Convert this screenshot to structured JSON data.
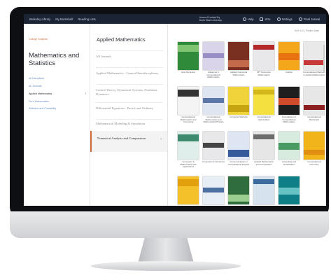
{
  "topbar": {
    "nav": [
      "Berkeley Library",
      "My Bookshelf",
      "Reading Lists"
    ],
    "access_line1": "Access Provided By",
    "access_line2": "North State University",
    "help": "Help",
    "size": "Size",
    "settings": "Settings",
    "account": "Pinal Jaswal"
  },
  "left": {
    "breadcrumb": "College Subjects",
    "subject_title": "Mathematics and Statistics",
    "links": [
      "All Disciplines",
      "All Journals"
    ],
    "active_item": "Applied Mathematics",
    "more_links": [
      "Pure Mathematics",
      "Statistics and Probability"
    ]
  },
  "middle": {
    "title": "Applied Mathematics",
    "items": [
      "All Journals",
      "Applied Mathematics - General/Interdisciplinary",
      "Control Theory, Dynamical Systems, Nonlinear Dynamics",
      "Differential Equations - Partial and Ordinary",
      "Mathematical Modeling & Simulation"
    ],
    "active": "Numerical Analysis and Computation"
  },
  "right": {
    "sort_label": "Sort: A-Z | Publish Date",
    "covers": [
      {
        "title": "Acta Numerica",
        "bg": "#2f8a3a",
        "accent": "#7fc470"
      },
      {
        "title": "Advances in Computational Mathematics",
        "bg": "#d9d4e9",
        "accent": "#9a8fc4"
      },
      {
        "title": "Applied Numerical Mathematics",
        "bg": "#7a3020",
        "accent": "#c26a4a"
      },
      {
        "title": "BIT Numerical Mathematics",
        "bg": "#e8e8ea",
        "accent": "#b52b2b"
      },
      {
        "title": "Calcolo",
        "bg": "#f3a81c",
        "accent": "#e7720f"
      },
      {
        "title": "Computational Methods in Applied Mathematics",
        "bg": "#e9e9e9",
        "accent": "#c83a3a"
      },
      {
        "title": "Computational Mathematics and Computing",
        "bg": "#f4f4f4",
        "accent": "#333333"
      },
      {
        "title": "Computational Mathematics and Mathematical Physics",
        "bg": "#dfe6f2",
        "accent": "#5b76a8"
      },
      {
        "title": "Computer Methods",
        "bg": "#f0d23b",
        "accent": "#c7a512"
      },
      {
        "title": "Computational Optimization",
        "bg": "#f4e03f",
        "accent": "#d3b71a"
      },
      {
        "title": "Foundations of Computational Mathematics",
        "bg": "#1e1e1e",
        "accent": "#d04a2c"
      },
      {
        "title": "Computational Mechanics",
        "bg": "#e7e7e7",
        "accent": "#8c2020"
      },
      {
        "title": "Computers & Mathematics with Applications",
        "bg": "#dfeeea",
        "accent": "#3e8a6e"
      },
      {
        "title": "Computers & Structures",
        "bg": "#e8e8ea",
        "accent": "#444444"
      },
      {
        "title": "Communications in Computational Physics",
        "bg": "#dde6f2",
        "accent": "#355b9a"
      },
      {
        "title": "Applied Mathematics and Computation",
        "bg": "#e6e6e6",
        "accent": "#6c6c6c"
      },
      {
        "title": "Computing and Visualization",
        "bg": "#d7ecdf",
        "accent": "#4a9a64"
      },
      {
        "title": "Computational Geometry",
        "bg": "#f1b51b",
        "accent": "#df8e12"
      },
      {
        "title": "Numerische Mathematik",
        "bg": "#f5c12a",
        "accent": "#e3a00d"
      },
      {
        "title": "Finite Fields and Their Applications",
        "bg": "#e8eef6",
        "accent": "#4d6fa0"
      },
      {
        "title": "Mathematics of Computation",
        "bg": "#2f6e3c",
        "accent": "#9ccf8f"
      },
      {
        "title": "International Journal of Computer Mathematics",
        "bg": "#d6e2ee",
        "accent": "#3b6c9d"
      },
      {
        "title": "International Journal of Numerical Methods",
        "bg": "#0f7f86",
        "accent": "#67c2c4"
      }
    ]
  }
}
